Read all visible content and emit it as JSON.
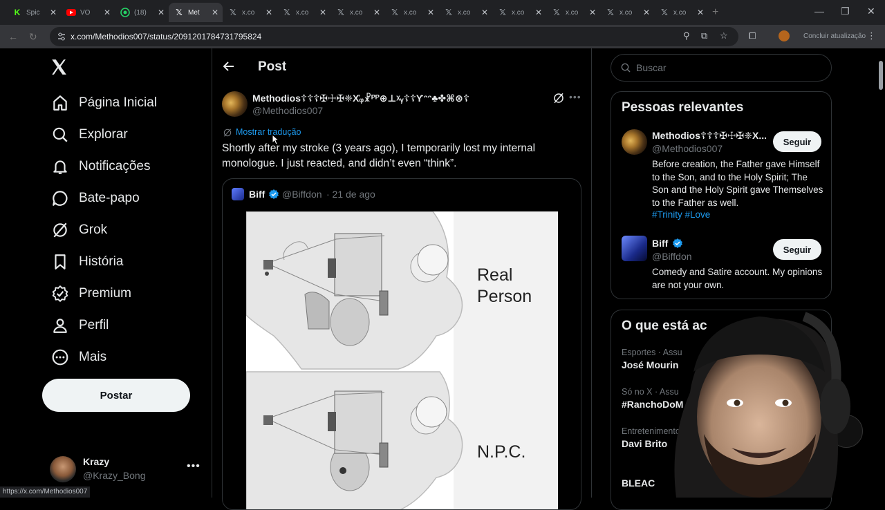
{
  "browser": {
    "tabs": [
      {
        "icon": "kick-icon",
        "color": "#53fc18",
        "title": "Spic"
      },
      {
        "icon": "youtube-icon",
        "color": "#ff0000",
        "title": "VO"
      },
      {
        "icon": "whatsapp-icon",
        "color": "#25d366",
        "title": "(18)"
      },
      {
        "icon": "x-icon",
        "color": "#e8eaed",
        "title": "Met"
      },
      {
        "icon": "x-icon",
        "color": "#e8eaed",
        "title": "x.co"
      },
      {
        "icon": "x-icon",
        "color": "#e8eaed",
        "title": "x.co"
      },
      {
        "icon": "x-icon",
        "color": "#e8eaed",
        "title": "x.co"
      },
      {
        "icon": "x-icon",
        "color": "#e8eaed",
        "title": "x.co"
      },
      {
        "icon": "x-icon",
        "color": "#e8eaed",
        "title": "x.co"
      },
      {
        "icon": "x-icon",
        "color": "#e8eaed",
        "title": "x.co"
      },
      {
        "icon": "x-icon",
        "color": "#e8eaed",
        "title": "x.co"
      },
      {
        "icon": "x-icon",
        "color": "#e8eaed",
        "title": "x.co"
      },
      {
        "icon": "x-icon",
        "color": "#e8eaed",
        "title": "x.co"
      }
    ],
    "active_tab": 3,
    "url": "x.com/Methodios007/status/2091201784731795824",
    "update_label": "Concluir atualização",
    "status_url": "https://x.com/Methodios007"
  },
  "sidebar": {
    "items": [
      {
        "icon": "home-icon",
        "label": "Página Inicial"
      },
      {
        "icon": "search-icon",
        "label": "Explorar"
      },
      {
        "icon": "bell-icon",
        "label": "Notificações"
      },
      {
        "icon": "chat-icon",
        "label": "Bate-papo"
      },
      {
        "icon": "grok-icon",
        "label": "Grok"
      },
      {
        "icon": "bookmark-icon",
        "label": "História"
      },
      {
        "icon": "premium-icon",
        "label": "Premium"
      },
      {
        "icon": "person-icon",
        "label": "Perfil"
      },
      {
        "icon": "more-icon",
        "label": "Mais"
      }
    ],
    "post_button": "Postar",
    "account": {
      "name": "Krazy",
      "handle": "@Krazy_Bong"
    }
  },
  "post": {
    "header_title": "Post",
    "author_name": "Methodios☦☦☦✠☩✠❈Χ҆ᵩ☧ᴾᴾ⊕⊥ᵡᵧ☦☦Ƴᵔᵔ♣✤⌘⊛☦",
    "author_handle": "@Methodios007",
    "translate_label": "Mostrar tradução",
    "text": "Shortly after my stroke (3 years ago), I temporarily lost my internal monologue. I just reacted, and didn’t even “think”.",
    "quote": {
      "name": "Biff",
      "handle": "@Biffdon",
      "date": "· 21 de ago",
      "panel_top_label_1": "Real",
      "panel_top_label_2": "Person",
      "panel_bottom_label": "N.P.C."
    }
  },
  "right": {
    "search_placeholder": "Buscar",
    "relevant_title": "Pessoas relevantes",
    "people": [
      {
        "name": "Methodios☦☦☦✠☩✠❈Χ...",
        "handle": "@Methodios007",
        "follow": "Seguir",
        "bio": "Before creation, the Father gave Himself to the Son, and to the Holy Spirit; The Son and the Holy Spirit gave Themselves to the Father as well.",
        "tags": "#Trinity #Love"
      },
      {
        "name": "Biff",
        "handle": "@Biffdon",
        "follow": "Seguir",
        "bio": "Comedy and Satire account. My opinions are not your own.",
        "tags": ""
      }
    ],
    "trends_title": "O que está ac",
    "trends": [
      {
        "category": "Esportes · Assu",
        "title": "José Mourin"
      },
      {
        "category": "Só no X · Assu",
        "title": "#RanchoDoM"
      },
      {
        "category": "Entretenimento · Ass",
        "title": "Davi Brito"
      },
      {
        "category": "",
        "title": "BLEAC"
      }
    ]
  }
}
